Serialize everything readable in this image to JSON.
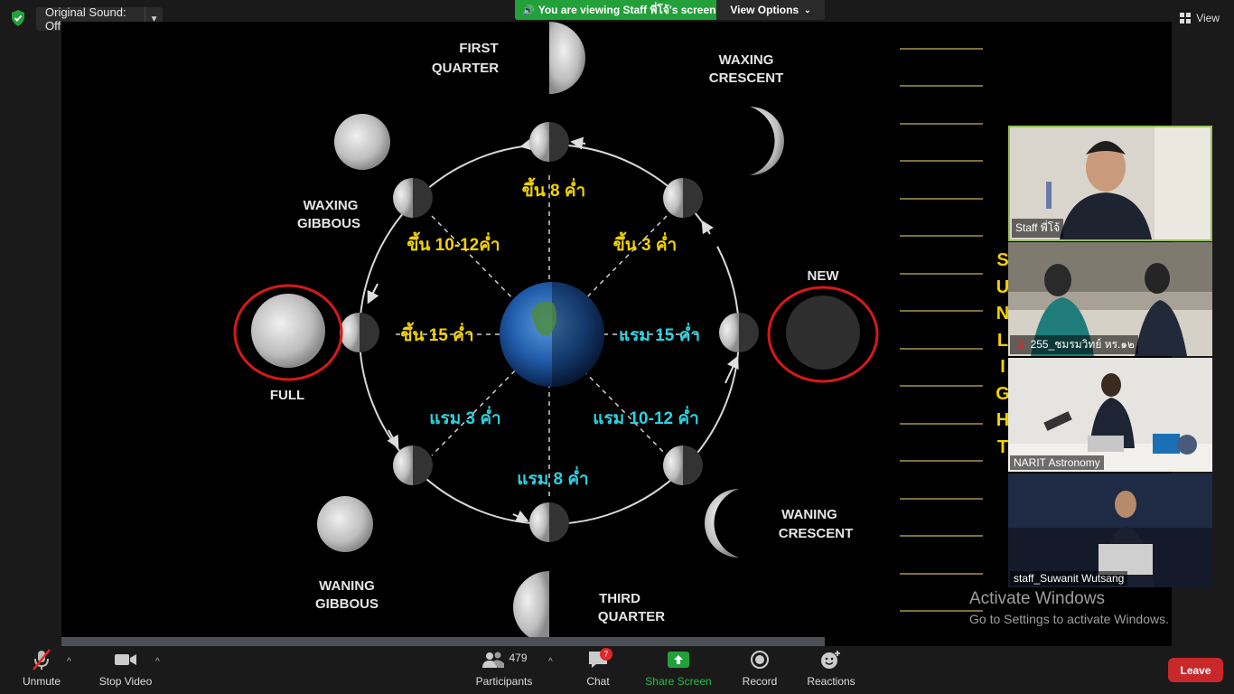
{
  "top_bar": {
    "original_sound": "Original Sound: Off",
    "viewing_banner": "You are viewing Staff พี่โจ้'s screen",
    "view_options": "View Options",
    "view": "View"
  },
  "share": {
    "phases": {
      "first_quarter": [
        "FIRST",
        "QUARTER"
      ],
      "waxing_crescent": [
        "WAXING",
        "CRESCENT"
      ],
      "waxing_gibbous": [
        "WAXING",
        "GIBBOUS"
      ],
      "new": "NEW",
      "full": "FULL",
      "waning_gibbous": [
        "WANING",
        "GIBBOUS"
      ],
      "waning_crescent": [
        "WANING",
        "CRESCENT"
      ],
      "third_quarter": [
        "THIRD",
        "QUARTER"
      ]
    },
    "thai_labels": {
      "wax8": "ขึ้น 8 ค่ำ",
      "wax10_12": "ขึ้น 10-12ค่ำ",
      "wax3": "ขึ้น 3 ค่ำ",
      "wax15": "ขึ้น 15 ค่ำ",
      "wan15": "แรม 15 ค่ำ",
      "wan3": "แรม 3 ค่ำ",
      "wan10_12": "แรม 10-12 ค่ำ",
      "wan8": "แรม 8 ค่ำ"
    },
    "sunlight_letters": [
      "S",
      "U",
      "N",
      "L",
      "I",
      "G",
      "H",
      "T"
    ]
  },
  "gallery": [
    {
      "name": "Staff พี่โจ้"
    },
    {
      "name": "255_ชมรมวิทย์ หร.๑๒"
    },
    {
      "name": "NARIT Astronomy"
    },
    {
      "name": "staff_Suwanit Wutsang"
    }
  ],
  "activate": {
    "title": "Activate Windows",
    "subtitle": "Go to Settings to activate Windows."
  },
  "toolbar": {
    "unmute": "Unmute",
    "stop_video": "Stop Video",
    "participants": "Participants",
    "participants_count": "479",
    "chat": "Chat",
    "chat_badge": "7",
    "share_screen": "Share Screen",
    "record": "Record",
    "reactions": "Reactions",
    "leave": "Leave"
  },
  "colors": {
    "banner_green": "#23a03a",
    "leave_red": "#c8282a",
    "share_green": "#23a03a",
    "label_yellow": "#f2d200",
    "label_cyan": "#2ed1e0",
    "ring_red": "#d81818"
  }
}
